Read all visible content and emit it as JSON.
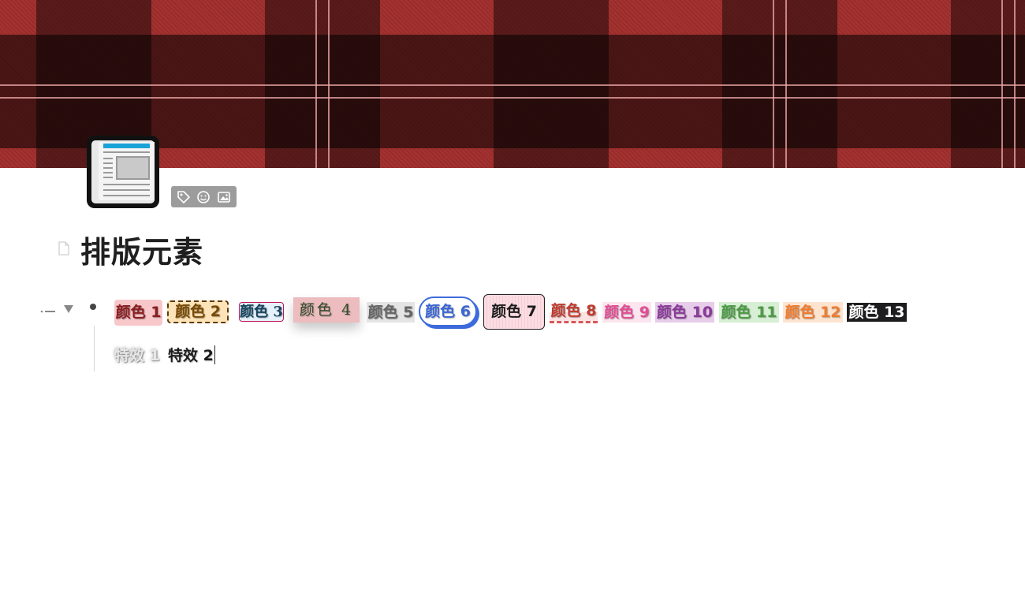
{
  "page": {
    "title": "排版元素",
    "icon": "newspaper-icon"
  },
  "icon_toolbar": {
    "items": [
      "tag-icon",
      "emoji-icon",
      "image-icon"
    ]
  },
  "banner": {
    "pattern": "red-tartan",
    "colors": {
      "base": "#a3312f",
      "dark": "#2e0f0f",
      "stripe": "#f0aaaa"
    }
  },
  "block": {
    "line1": [
      {
        "id": "c1",
        "text": "颜色 1"
      },
      {
        "id": "c2",
        "text": "颜色 2"
      },
      {
        "id": "c3",
        "text": "颜色 3"
      },
      {
        "id": "c4",
        "text": "颜色 4"
      },
      {
        "id": "c5",
        "text": "颜色 5"
      },
      {
        "id": "c6",
        "text": "颜色 6"
      },
      {
        "id": "c7",
        "text": "颜色 7"
      },
      {
        "id": "c8",
        "text": "颜色 8"
      },
      {
        "id": "c9",
        "text": "颜色 9"
      },
      {
        "id": "c10",
        "text": "颜色 10"
      },
      {
        "id": "c11",
        "text": "颜色 11"
      },
      {
        "id": "c12",
        "text": "颜色 12"
      },
      {
        "id": "c13",
        "text": "颜色 13"
      }
    ],
    "line2": [
      {
        "id": "e1",
        "text": "特效 1"
      },
      {
        "id": "e2",
        "text": "特效 2"
      }
    ]
  }
}
